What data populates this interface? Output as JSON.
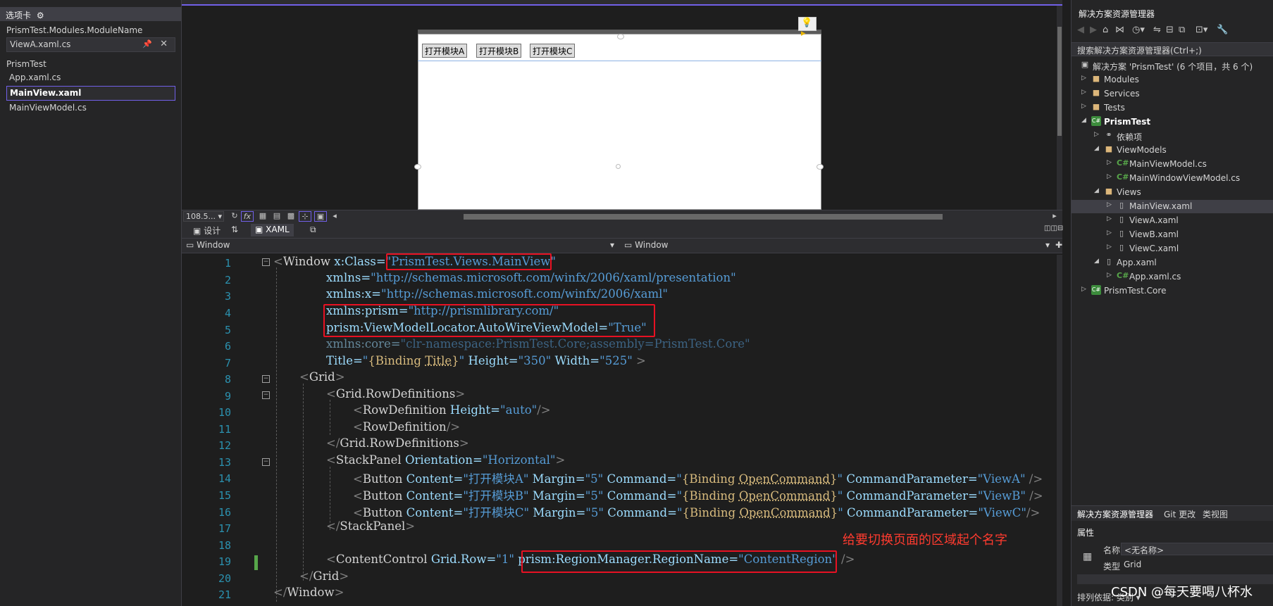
{
  "left_panel": {
    "header": "选项卡",
    "group1": "PrismTest.Modules.ModuleName",
    "file_pinned": "ViewA.xaml.cs",
    "group2": "PrismTest",
    "files": [
      "App.xaml.cs",
      "MainView.xaml",
      "MainViewModel.cs"
    ]
  },
  "designer": {
    "buttons": [
      "打开模块A",
      "打开模块B",
      "打开模块C"
    ],
    "zoom": "108.5..."
  },
  "split_tabs": {
    "design": "设计",
    "xaml": "XAML"
  },
  "nav": {
    "left": "Window",
    "right": "Window"
  },
  "editor": {
    "line_numbers": [
      "1",
      "2",
      "3",
      "4",
      "5",
      "6",
      "7",
      "8",
      "9",
      "10",
      "11",
      "12",
      "13",
      "14",
      "15",
      "16",
      "17",
      "18",
      "19",
      "20",
      "21"
    ],
    "line1": {
      "open": "<",
      "tag": "Window",
      "attr": " x:Class=",
      "val": "\"PrismTest.Views.MainView\""
    },
    "line2": {
      "attr": "xmlns=",
      "val": "\"http://schemas.microsoft.com/winfx/2006/xaml/presentation\""
    },
    "line3": {
      "attr": "xmlns:x=",
      "val": "\"http://schemas.microsoft.com/winfx/2006/xaml\""
    },
    "line4": {
      "attr": "xmlns:prism=",
      "val": "\"http://prismlibrary.com/\""
    },
    "line5": {
      "attr": "prism:ViewModelLocator.AutoWireViewModel=",
      "val": "\"True\""
    },
    "line6": {
      "attr": "xmlns:core=",
      "val": "\"clr-namespace:PrismTest.Core;assembly=PrismTest.Core\""
    },
    "line7": {
      "attr1": "Title=",
      "v1a": "\"",
      "bind": "{Binding ",
      "bind2": "Title",
      "bind3": "}",
      "v1b": "\"",
      "attr2": " Height=",
      "v2": "\"350\"",
      "attr3": " Width=",
      "v3": "\"525\"",
      "close": " >"
    },
    "line8": {
      "open": "<",
      "tag": "Grid",
      "close": ">"
    },
    "line9": {
      "open": "<",
      "tag": "Grid.RowDefinitions",
      "close": ">"
    },
    "line10": {
      "open": "<",
      "tag": "RowDefinition",
      "attr": " Height=",
      "val": "\"auto\"",
      "close": "/>"
    },
    "line11": {
      "open": "<",
      "tag": "RowDefinition",
      "close": "/>"
    },
    "line12": {
      "open": "</",
      "tag": "Grid.RowDefinitions",
      "close": ">"
    },
    "line13": {
      "open": "<",
      "tag": "StackPanel",
      "attr": " Orientation=",
      "val": "\"Horizontal\"",
      "close": ">"
    },
    "line14": {
      "open": "<",
      "tag": "Button",
      "a1": " Content=",
      "v1": "\"打开模块A\"",
      "a2": " Margin=",
      "v2": "\"5\"",
      "a3": " Command=",
      "q1": "\"",
      "b1": "{Binding ",
      "b2": "OpenCommand",
      "b3": "}",
      "q2": "\"",
      "a4": " CommandParameter=",
      "v4": "\"ViewA\"",
      "close": " />"
    },
    "line15": {
      "open": "<",
      "tag": "Button",
      "a1": " Content=",
      "v1": "\"打开模块B\"",
      "a2": " Margin=",
      "v2": "\"5\"",
      "a3": " Command=",
      "q1": "\"",
      "b1": "{Binding ",
      "b2": "OpenCommand",
      "b3": "}",
      "q2": "\"",
      "a4": " CommandParameter=",
      "v4": "\"ViewB\"",
      "close": " />"
    },
    "line16": {
      "open": "<",
      "tag": "Button",
      "a1": " Content=",
      "v1": "\"打开模块C\"",
      "a2": " Margin=",
      "v2": "\"5\"",
      "a3": " Command=",
      "q1": "\"",
      "b1": "{Binding ",
      "b2": "OpenCommand",
      "b3": "}",
      "q2": "\"",
      "a4": " CommandParameter=",
      "v4": "\"ViewC\"",
      "close": "/>"
    },
    "line17": {
      "open": "</",
      "tag": "StackPanel",
      "close": ">"
    },
    "line19": {
      "open": "<",
      "tag": "ContentControl",
      "a1": " Grid.Row=",
      "v1": "\"1\"",
      "a2": " prism:RegionManager.RegionName=",
      "v2": "\"ContentRegion\"",
      "close": " />"
    },
    "line20": {
      "open": "</",
      "tag": "Grid",
      "close": ">"
    },
    "line21": {
      "open": "</",
      "tag": "Window",
      "close": ">"
    },
    "annotation": "给要切换页面的区域起个名字"
  },
  "solution_explorer": {
    "title": "解决方案资源管理器",
    "search": "搜索解决方案资源管理器(Ctrl+;)",
    "items": [
      {
        "label": "解决方案 'PrismTest' (6 个项目，共 6 个)"
      },
      {
        "label": "Modules"
      },
      {
        "label": "Services"
      },
      {
        "label": "Tests"
      },
      {
        "label": "PrismTest"
      },
      {
        "label": "依赖项"
      },
      {
        "label": "ViewModels"
      },
      {
        "label": "MainViewModel.cs"
      },
      {
        "label": "MainWindowViewModel.cs"
      },
      {
        "label": "Views"
      },
      {
        "label": "MainView.xaml"
      },
      {
        "label": "ViewA.xaml"
      },
      {
        "label": "ViewB.xaml"
      },
      {
        "label": "ViewC.xaml"
      },
      {
        "label": "App.xaml"
      },
      {
        "label": "App.xaml.cs"
      },
      {
        "label": "PrismTest.Core"
      }
    ],
    "bottom_tabs": [
      "解决方案资源管理器",
      "Git 更改",
      "类视图"
    ]
  },
  "properties": {
    "title": "属性",
    "name_label": "名称",
    "name_value": "<无名称>",
    "type_label": "类型",
    "type_value": "Grid",
    "sort_label": "排列依据: 类别"
  },
  "watermark": "CSDN @每天要喝八杯水",
  "colors": {
    "accent": "#7160e8",
    "highlight_box": "#e81123",
    "annotation": "#ff3b2f"
  }
}
